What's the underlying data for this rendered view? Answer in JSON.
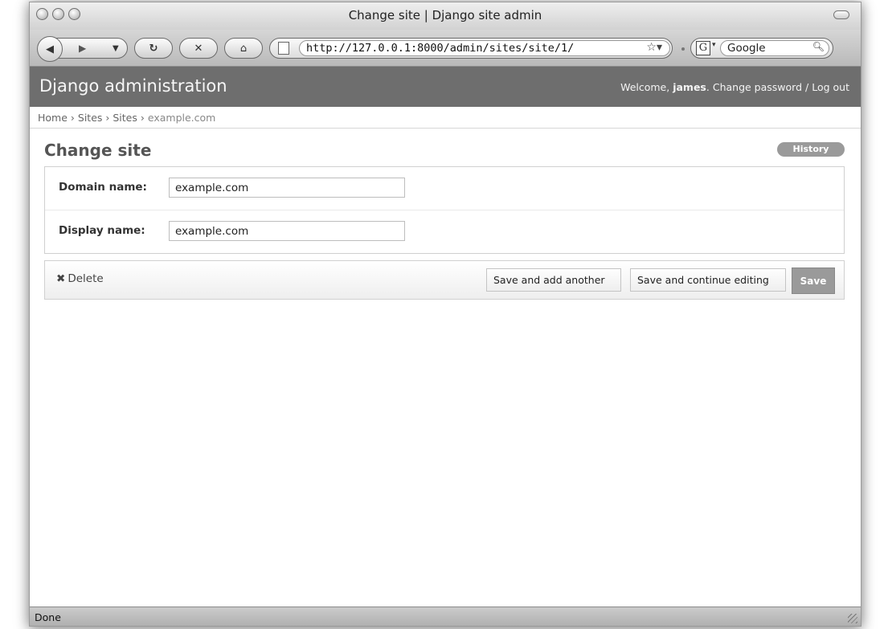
{
  "window": {
    "title": "Change site | Django site admin"
  },
  "toolbar": {
    "url": "http://127.0.0.1:8000/admin/sites/site/1/",
    "search_engine_letter": "G",
    "search_placeholder": "Google"
  },
  "header": {
    "brand": "Django administration",
    "welcome": "Welcome,",
    "username": "james",
    "change_password": "Change password",
    "separator": "/",
    "logout": "Log out"
  },
  "breadcrumbs": {
    "home": "Home",
    "app": "Sites",
    "model": "Sites",
    "current": "example.com",
    "sep": "›"
  },
  "page": {
    "title": "Change site",
    "history": "History"
  },
  "form": {
    "domain_label": "Domain name:",
    "domain_value": "example.com",
    "display_label": "Display name:",
    "display_value": "example.com"
  },
  "actions": {
    "delete": "Delete",
    "delete_icon": "✖",
    "save_add_another": "Save and add another",
    "save_continue": "Save and continue editing",
    "save": "Save"
  },
  "status": {
    "text": "Done"
  }
}
